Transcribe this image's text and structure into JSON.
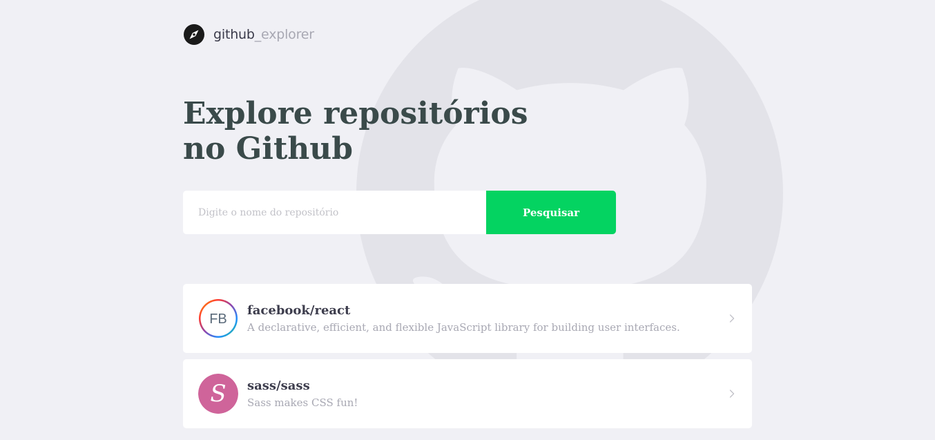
{
  "brand": {
    "name_part1": "github",
    "name_part2": "_explorer",
    "icon": "compass-icon"
  },
  "hero": {
    "title_line1": "Explore repositórios",
    "title_line2": "no Github"
  },
  "search": {
    "placeholder": "Digite o nome do repositório",
    "value": "",
    "button_label": "Pesquisar"
  },
  "repositories": [
    {
      "name": "facebook/react",
      "description": "A declarative, efficient, and flexible JavaScript library for building user interfaces.",
      "avatar_text": "FB",
      "avatar_icon": "facebook-avatar",
      "chevron_icon": "chevron-right-icon"
    },
    {
      "name": "sass/sass",
      "description": "Sass makes CSS fun!",
      "avatar_text": "S",
      "avatar_icon": "sass-avatar",
      "chevron_icon": "chevron-right-icon"
    }
  ],
  "colors": {
    "background": "#f0f0f5",
    "accent_green": "#04d361",
    "title": "#3a4a4a",
    "muted": "#a8a8b3",
    "sass_pink": "#cf649a"
  }
}
